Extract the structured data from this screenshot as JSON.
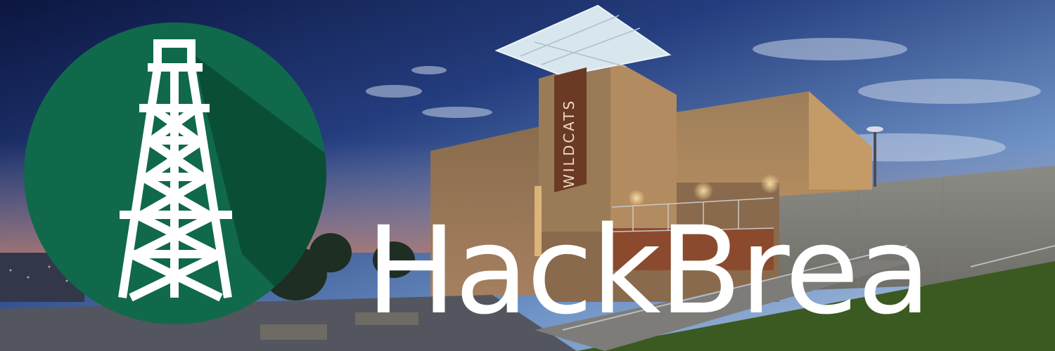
{
  "banner": {
    "headline": "HackBrea",
    "building_sign": "WILDCATS",
    "logo_icon": "oil-derrick-icon",
    "colors": {
      "logo_green": "#10694a",
      "logo_shadow": "#0b4a33",
      "sky_top": "#0d1a4a",
      "sky_bottom": "#8fb0d4",
      "wall": "#a2825c",
      "sign_panel": "#6b3a24",
      "lawn": "#3a5a22",
      "headline_text": "#ffffff"
    }
  }
}
